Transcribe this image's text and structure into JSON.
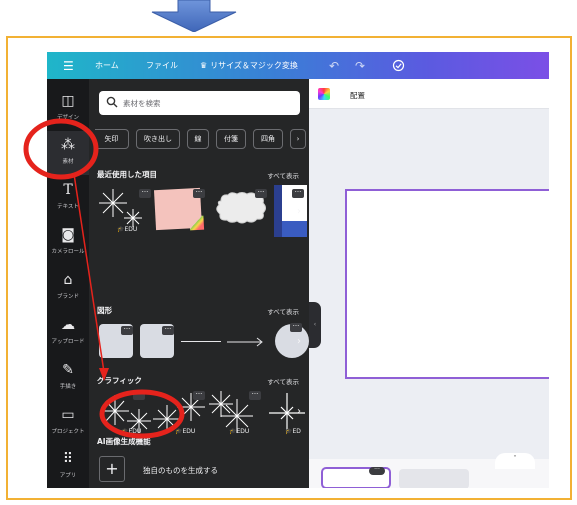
{
  "topbar": {
    "menu_icon": "menu-icon",
    "home": "ホーム",
    "file": "ファイル",
    "resize": "リサイズ＆マジック変換",
    "resize_icon": "crown-icon",
    "undo_icon": "undo-icon",
    "redo_icon": "redo-icon",
    "cloud_icon": "cloud-sync-icon"
  },
  "rail": {
    "items": [
      {
        "label": "デザイン",
        "icon": "design-icon"
      },
      {
        "label": "素材",
        "icon": "elements-icon"
      },
      {
        "label": "テキスト",
        "icon": "text-icon"
      },
      {
        "label": "カメラロール",
        "icon": "camera-icon"
      },
      {
        "label": "ブランド",
        "icon": "brand-icon"
      },
      {
        "label": "アップロード",
        "icon": "upload-icon"
      },
      {
        "label": "手描き",
        "icon": "draw-icon"
      },
      {
        "label": "プロジェクト",
        "icon": "folder-icon"
      },
      {
        "label": "アプリ",
        "icon": "apps-icon"
      }
    ]
  },
  "panel": {
    "search_placeholder": "素材を検索",
    "chips": [
      "矢印",
      "吹き出し",
      "線",
      "付箋",
      "四角"
    ],
    "recent": {
      "title": "最近使用した項目",
      "see_all": "すべて表示",
      "badge": "EDU"
    },
    "shapes": {
      "title": "図形",
      "see_all": "すべて表示"
    },
    "graphics": {
      "title": "グラフィック",
      "see_all": "すべて表示",
      "badge": "EDU",
      "badge_cut": "ED"
    },
    "ai": {
      "title": "AI画像生成機能",
      "generate_label": "独自のものを生成する"
    }
  },
  "editor": {
    "arrange": "配置"
  },
  "colors": {
    "annotation_red": "#e5231c",
    "frame_border": "#f2b134",
    "arrow_blue": "#4a73c4",
    "page_border": "#8f5fd6"
  }
}
